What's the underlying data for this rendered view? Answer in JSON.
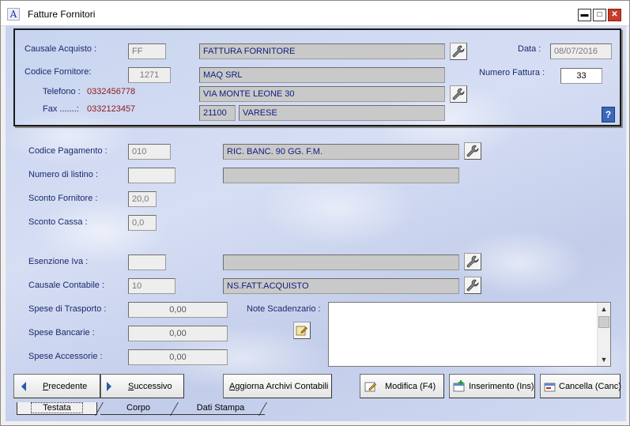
{
  "window": {
    "title": "Fatture Fornitori",
    "icon": "document-a-icon",
    "controls": {
      "minimize": "▬",
      "maximize": "□",
      "close": "✕"
    }
  },
  "header": {
    "causale_acquisto": {
      "label": "Causale Acquisto :",
      "code": "FF",
      "description": "FATTURA FORNITORE"
    },
    "data": {
      "label": "Data :",
      "value": "08/07/2016"
    },
    "codice_fornitore": {
      "label": "Codice Fornitore:",
      "code": "1271",
      "name": "MAQ SRL"
    },
    "numero_fattura": {
      "label": "Numero Fattura :",
      "value": "33"
    },
    "telefono": {
      "label": "Telefono :",
      "value": "0332456778"
    },
    "fax": {
      "label": "Fax .......:",
      "value": "0332123457"
    },
    "indirizzo": "VIA MONTE LEONE 30",
    "cap": "21100",
    "citta": "VARESE",
    "help": "?"
  },
  "form": {
    "codice_pagamento": {
      "label": "Codice Pagamento :",
      "code": "010",
      "description": "RIC. BANC. 90 GG. F.M."
    },
    "numero_listino": {
      "label": "Numero di listino :",
      "code": "",
      "description": ""
    },
    "sconto_fornitore": {
      "label": "Sconto Fornitore :",
      "value": "20,0"
    },
    "sconto_cassa": {
      "label": "Sconto Cassa :",
      "value": "0,0"
    },
    "esenzione_iva": {
      "label": "Esenzione Iva :",
      "code": "",
      "description": ""
    },
    "causale_contabile": {
      "label": "Causale Contabile :",
      "code": "10",
      "description": "NS.FATT.ACQUISTO"
    },
    "spese_trasporto": {
      "label": "Spese di Trasporto :",
      "value": "0,00"
    },
    "spese_bancarie": {
      "label": "Spese Bancarie :",
      "value": "0,00"
    },
    "spese_accessorie": {
      "label": "Spese Accessorie :",
      "value": "0,00"
    },
    "note_scadenzario": {
      "label": "Note Scadenzario :",
      "value": ""
    }
  },
  "buttons": {
    "precedente": {
      "accel": "P",
      "rest": "recedente"
    },
    "successivo": {
      "accel": "S",
      "rest": "uccessivo"
    },
    "aggiorna": {
      "accel": "A",
      "rest": "ggiorna Archivi Contabili"
    },
    "modifica": "Modifica (F4)",
    "inserimento": "Inserimento (Ins)",
    "cancella": "Cancella (Canc)"
  },
  "tabs": [
    {
      "label": "Testata",
      "active": true
    },
    {
      "label": "Corpo",
      "active": false
    },
    {
      "label": "Dati Stampa",
      "active": false
    }
  ],
  "colors": {
    "label": "#1a2a6c",
    "phone": "#8b1a1a",
    "field_gray": "#c9c9c9",
    "background": "#cdd6f0"
  }
}
